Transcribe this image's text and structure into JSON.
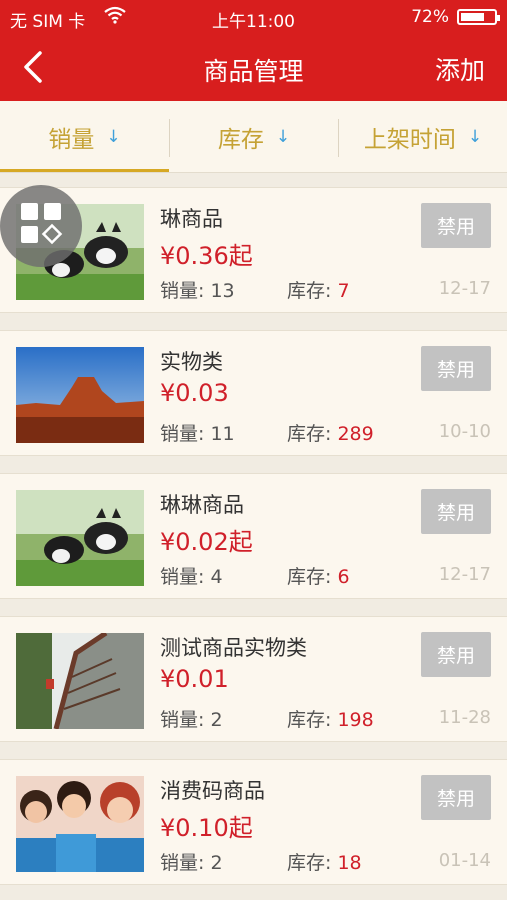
{
  "status": {
    "carrier": "无 SIM 卡",
    "time": "上午11:00",
    "battery": "72%",
    "battery_level": 0.72
  },
  "nav": {
    "title": "商品管理",
    "add_label": "添加"
  },
  "sort": {
    "tabs": [
      {
        "label": "销量",
        "arrow": "↓"
      },
      {
        "label": "库存",
        "arrow": "↓"
      },
      {
        "label": "上架时间",
        "arrow": "↓"
      }
    ],
    "active": 0
  },
  "labels": {
    "sales": "销量: ",
    "stock": "库存: ",
    "disable": "禁用"
  },
  "products": [
    {
      "name": "琳商品",
      "price": "¥0.36起",
      "sales": "13",
      "stock": "7",
      "date": "12-17",
      "image": "dogs"
    },
    {
      "name": "实物类",
      "price": "¥0.03",
      "sales": "11",
      "stock": "289",
      "date": "10-10",
      "image": "desert"
    },
    {
      "name": "琳琳商品",
      "price": "¥0.02起",
      "sales": "4",
      "stock": "6",
      "date": "12-17",
      "image": "dogs"
    },
    {
      "name": "测试商品实物类",
      "price": "¥0.01",
      "sales": "2",
      "stock": "198",
      "date": "11-28",
      "image": "bridge"
    },
    {
      "name": "消费码商品",
      "price": "¥0.10起",
      "sales": "2",
      "stock": "18",
      "date": "01-14",
      "image": "group"
    }
  ]
}
